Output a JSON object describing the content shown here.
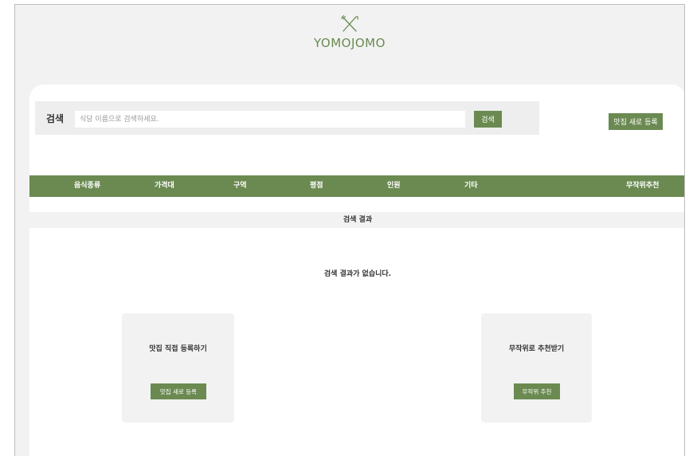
{
  "brand": {
    "name": "YOMOJOMO",
    "logo_icon": "fork-and-knife-icon",
    "color": "#6b8a51"
  },
  "search": {
    "label": "검색",
    "placeholder": "식당 이름으로 검색하세요.",
    "button_label": "검색"
  },
  "register_button_label": "맛집 새로 등록",
  "filters": [
    "음식종류",
    "가격대",
    "구역",
    "평점",
    "인원",
    "기타"
  ],
  "random_recommend_label": "무작위추천",
  "results": {
    "title": "검색 결과",
    "empty_message": "검색 결과가 없습니다."
  },
  "cards": [
    {
      "title": "맛집 직접 등록하기",
      "button_label": "맛집 새로 등록"
    },
    {
      "title": "무작위로 추천받기",
      "button_label": "무작위 추천"
    }
  ],
  "colors": {
    "accent": "#6b8a51",
    "background": "#f2f2f2",
    "panel": "#ffffff"
  }
}
